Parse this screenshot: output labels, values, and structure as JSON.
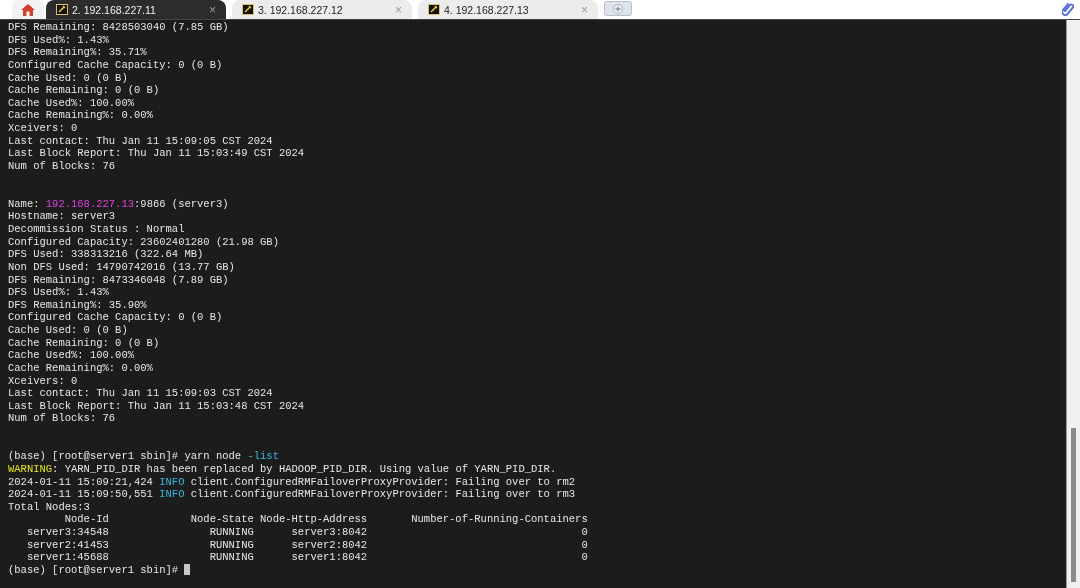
{
  "tabs": [
    {
      "label": "2. 192.168.227.11",
      "selected": true,
      "close": "×"
    },
    {
      "label": "3. 192.168.227.12",
      "selected": false,
      "close": "×"
    },
    {
      "label": "4. 192.168.227.13",
      "selected": false,
      "close": "×"
    }
  ],
  "terminal": {
    "cursor_visible": true,
    "blocks": [
      [
        [
          {
            "text": "DFS Remaining: 8428503040 (7.85 GB)",
            "kind": "plain"
          }
        ],
        [
          {
            "text": "DFS Used%: 1.43%",
            "kind": "plain"
          }
        ],
        [
          {
            "text": "DFS Remaining%: 35.71%",
            "kind": "plain"
          }
        ],
        [
          {
            "text": "Configured Cache Capacity: 0 (0 B)",
            "kind": "plain"
          }
        ],
        [
          {
            "text": "Cache Used: 0 (0 B)",
            "kind": "plain"
          }
        ],
        [
          {
            "text": "Cache Remaining: 0 (0 B)",
            "kind": "plain"
          }
        ],
        [
          {
            "text": "Cache Used%: 100.00%",
            "kind": "plain"
          }
        ],
        [
          {
            "text": "Cache Remaining%: 0.00%",
            "kind": "plain"
          }
        ],
        [
          {
            "text": "Xceivers: 0",
            "kind": "plain"
          }
        ],
        [
          {
            "text": "Last contact: Thu Jan 11 15:09:05 CST 2024",
            "kind": "plain"
          }
        ],
        [
          {
            "text": "Last Block Report: Thu Jan 11 15:03:49 CST 2024",
            "kind": "plain"
          }
        ],
        [
          {
            "text": "Num of Blocks: 76",
            "kind": "plain"
          }
        ]
      ],
      [
        [
          {
            "text": "Name: ",
            "kind": "plain"
          },
          {
            "text": "192.168.227.13",
            "kind": "ip"
          },
          {
            "text": ":9866 (server3)",
            "kind": "plain"
          }
        ],
        [
          {
            "text": "Hostname: server3",
            "kind": "plain"
          }
        ],
        [
          {
            "text": "Decommission Status : Normal",
            "kind": "plain"
          }
        ],
        [
          {
            "text": "Configured Capacity: 23602401280 (21.98 GB)",
            "kind": "plain"
          }
        ],
        [
          {
            "text": "DFS Used: 338313216 (322.64 MB)",
            "kind": "plain"
          }
        ],
        [
          {
            "text": "Non DFS Used: 14790742016 (13.77 GB)",
            "kind": "plain"
          }
        ],
        [
          {
            "text": "DFS Remaining: 8473346048 (7.89 GB)",
            "kind": "plain"
          }
        ],
        [
          {
            "text": "DFS Used%: 1.43%",
            "kind": "plain"
          }
        ],
        [
          {
            "text": "DFS Remaining%: 35.90%",
            "kind": "plain"
          }
        ],
        [
          {
            "text": "Configured Cache Capacity: 0 (0 B)",
            "kind": "plain"
          }
        ],
        [
          {
            "text": "Cache Used: 0 (0 B)",
            "kind": "plain"
          }
        ],
        [
          {
            "text": "Cache Remaining: 0 (0 B)",
            "kind": "plain"
          }
        ],
        [
          {
            "text": "Cache Used%: 100.00%",
            "kind": "plain"
          }
        ],
        [
          {
            "text": "Cache Remaining%: 0.00%",
            "kind": "plain"
          }
        ],
        [
          {
            "text": "Xceivers: 0",
            "kind": "plain"
          }
        ],
        [
          {
            "text": "Last contact: Thu Jan 11 15:09:03 CST 2024",
            "kind": "plain"
          }
        ],
        [
          {
            "text": "Last Block Report: Thu Jan 11 15:03:48 CST 2024",
            "kind": "plain"
          }
        ],
        [
          {
            "text": "Num of Blocks: 76",
            "kind": "plain"
          }
        ]
      ],
      [
        [
          {
            "text": "(base) [root@server1 sbin]# yarn node ",
            "kind": "plain"
          },
          {
            "text": "-list",
            "kind": "flag"
          }
        ],
        [
          {
            "text": "WARNING",
            "kind": "warn"
          },
          {
            "text": ": YARN_PID_DIR has been replaced by HADOOP_PID_DIR. Using value of YARN_PID_DIR.",
            "kind": "plain"
          }
        ],
        [
          {
            "text": "2024-01-11 15:09:21,424 ",
            "kind": "plain"
          },
          {
            "text": "INFO",
            "kind": "info"
          },
          {
            "text": " client.ConfiguredRMFailoverProxyProvider: Failing over to rm2",
            "kind": "plain"
          }
        ],
        [
          {
            "text": "2024-01-11 15:09:50,551 ",
            "kind": "plain"
          },
          {
            "text": "INFO",
            "kind": "info"
          },
          {
            "text": " client.ConfiguredRMFailoverProxyProvider: Failing over to rm3",
            "kind": "plain"
          }
        ],
        [
          {
            "text": "Total Nodes:3",
            "kind": "plain"
          }
        ],
        [
          {
            "text": "         Node-Id             Node-State Node-Http-Address       Number-of-Running-Containers",
            "kind": "plain"
          }
        ],
        [
          {
            "text": "   server3:34548                RUNNING      server3:8042                                  0",
            "kind": "plain"
          }
        ],
        [
          {
            "text": "   server2:41453                RUNNING      server2:8042                                  0",
            "kind": "plain"
          }
        ],
        [
          {
            "text": "   server1:45688                RUNNING      server1:8042                                  0",
            "kind": "plain"
          }
        ],
        [
          {
            "text": "(base) [root@server1 sbin]# ",
            "kind": "plain"
          }
        ]
      ]
    ]
  }
}
